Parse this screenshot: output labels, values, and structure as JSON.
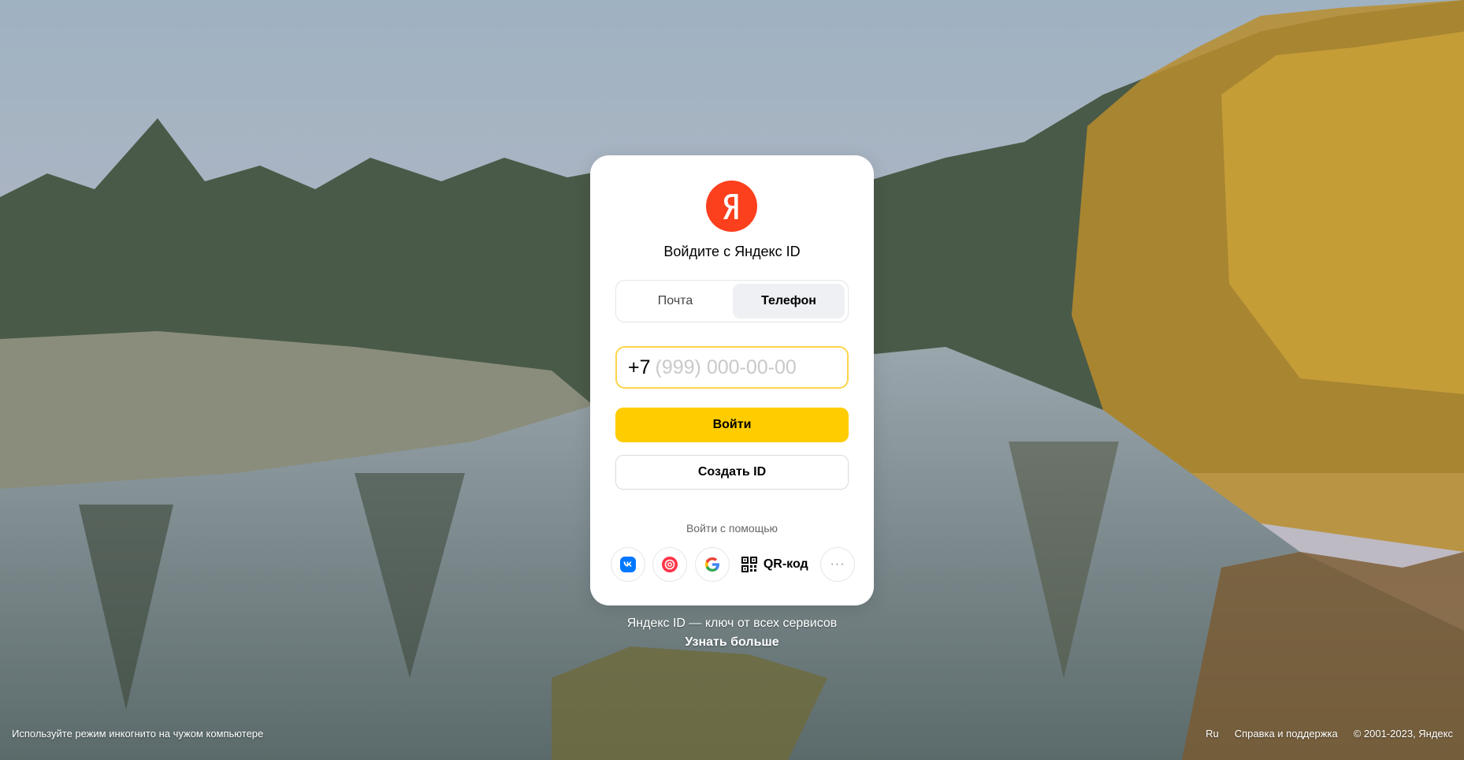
{
  "background": {
    "description_colors": {
      "sky": "#a9b8c4",
      "water": "#7d8e91",
      "forest_dark": "#3c4a3a",
      "foliage_gold": "#c69a2c"
    }
  },
  "card": {
    "logo_letter": "Я",
    "logo_color": "#fc3f1d",
    "title": "Войдите с Яндекс ID",
    "tabs": [
      {
        "label": "Почта",
        "active": false
      },
      {
        "label": "Телефон",
        "active": true
      }
    ],
    "phone": {
      "prefix": "+7",
      "placeholder": "(999) 000-00-00",
      "border_color": "#fdd44a"
    },
    "login_button": "Войти",
    "login_button_color": "#ffcc00",
    "create_button": "Создать ID",
    "alt_login_label": "Войти с помощью",
    "socials": [
      {
        "name": "vk-icon",
        "color": "#0077ff"
      },
      {
        "name": "mailru-icon",
        "color": "#ff3347"
      },
      {
        "name": "google-icon",
        "color": "#4285f4"
      }
    ],
    "qr_label": "QR-код",
    "more_label": "···"
  },
  "tagline": "Яндекс ID — ключ от всех сервисов",
  "learn_more": "Узнать больше",
  "footer": {
    "left": "Используйте режим инкогнито на чужом компьютере",
    "lang": "Ru",
    "help": "Справка и поддержка",
    "copyright": "© 2001-2023, Яндекс"
  }
}
